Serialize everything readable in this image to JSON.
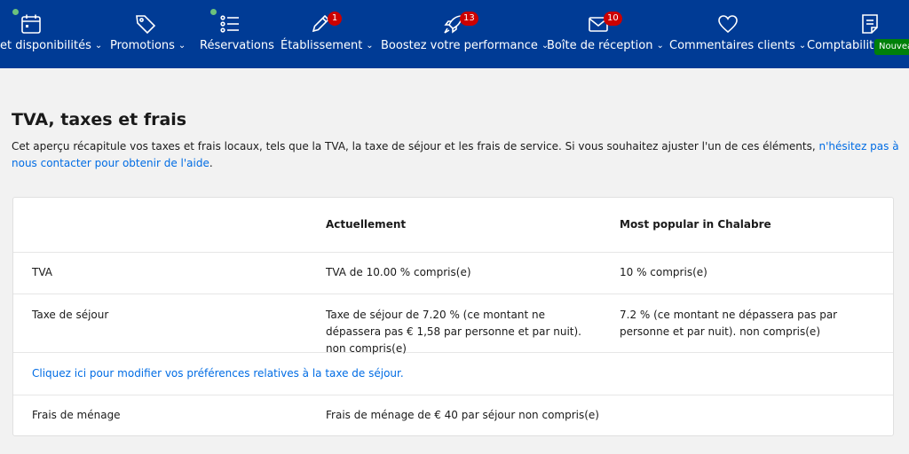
{
  "nav": {
    "items": [
      {
        "label": "et disponibilités",
        "icon": "calendar-icon",
        "has_chevron": true
      },
      {
        "label": "Promotions",
        "icon": "tag-icon",
        "has_chevron": true
      },
      {
        "label": "Réservations",
        "icon": "list-icon",
        "has_chevron": false
      },
      {
        "label": "Établissement",
        "icon": "pencil-icon",
        "has_chevron": true,
        "badge": "1"
      },
      {
        "label": "Boostez votre performance",
        "icon": "rocket-icon",
        "has_chevron": true,
        "badge": "13"
      },
      {
        "label": "Boîte de réception",
        "icon": "envelope-icon",
        "has_chevron": true,
        "badge": "10"
      },
      {
        "label": "Commentaires clients",
        "icon": "heart-icon",
        "has_chevron": true
      },
      {
        "label": "Comptabilité",
        "icon": "document-icon",
        "has_chevron": false,
        "new_badge": "Nouveau"
      }
    ]
  },
  "page": {
    "title": "TVA, taxes et frais",
    "intro_text": "Cet aperçu récapitule vos taxes et frais locaux, tels que la TVA, la taxe de séjour et les frais de service. Si vous souhaitez ajuster l'un de ces éléments, ",
    "intro_link": "n'hésitez pas à nous contacter pour obtenir de l'aide",
    "intro_end": "."
  },
  "table": {
    "headers": [
      "",
      "Actuellement",
      "Most popular in Chalabre"
    ],
    "rows": [
      {
        "label": "TVA",
        "current": "TVA de 10.00 % compris(e)",
        "popular": "10 % compris(e)"
      },
      {
        "label": "Taxe de séjour",
        "current": "Taxe de séjour de 7.20 % (ce montant ne dépassera pas € 1,58 par personne et par nuit). non compris(e)",
        "popular": "7.2 % (ce montant ne dépassera pas par personne et par nuit). non compris(e)"
      },
      {
        "link": "Cliquez ici pour modifier vos préférences relatives à la taxe de séjour."
      },
      {
        "label": "Frais de ménage",
        "current": "Frais de ménage de € 40 par séjour non compris(e)",
        "popular": ""
      }
    ]
  },
  "colors": {
    "nav_bg": "#003b95",
    "link": "#006ce4",
    "badge_red": "#cc0000",
    "new_green": "#008009",
    "status_dot": "#6bc27c"
  }
}
